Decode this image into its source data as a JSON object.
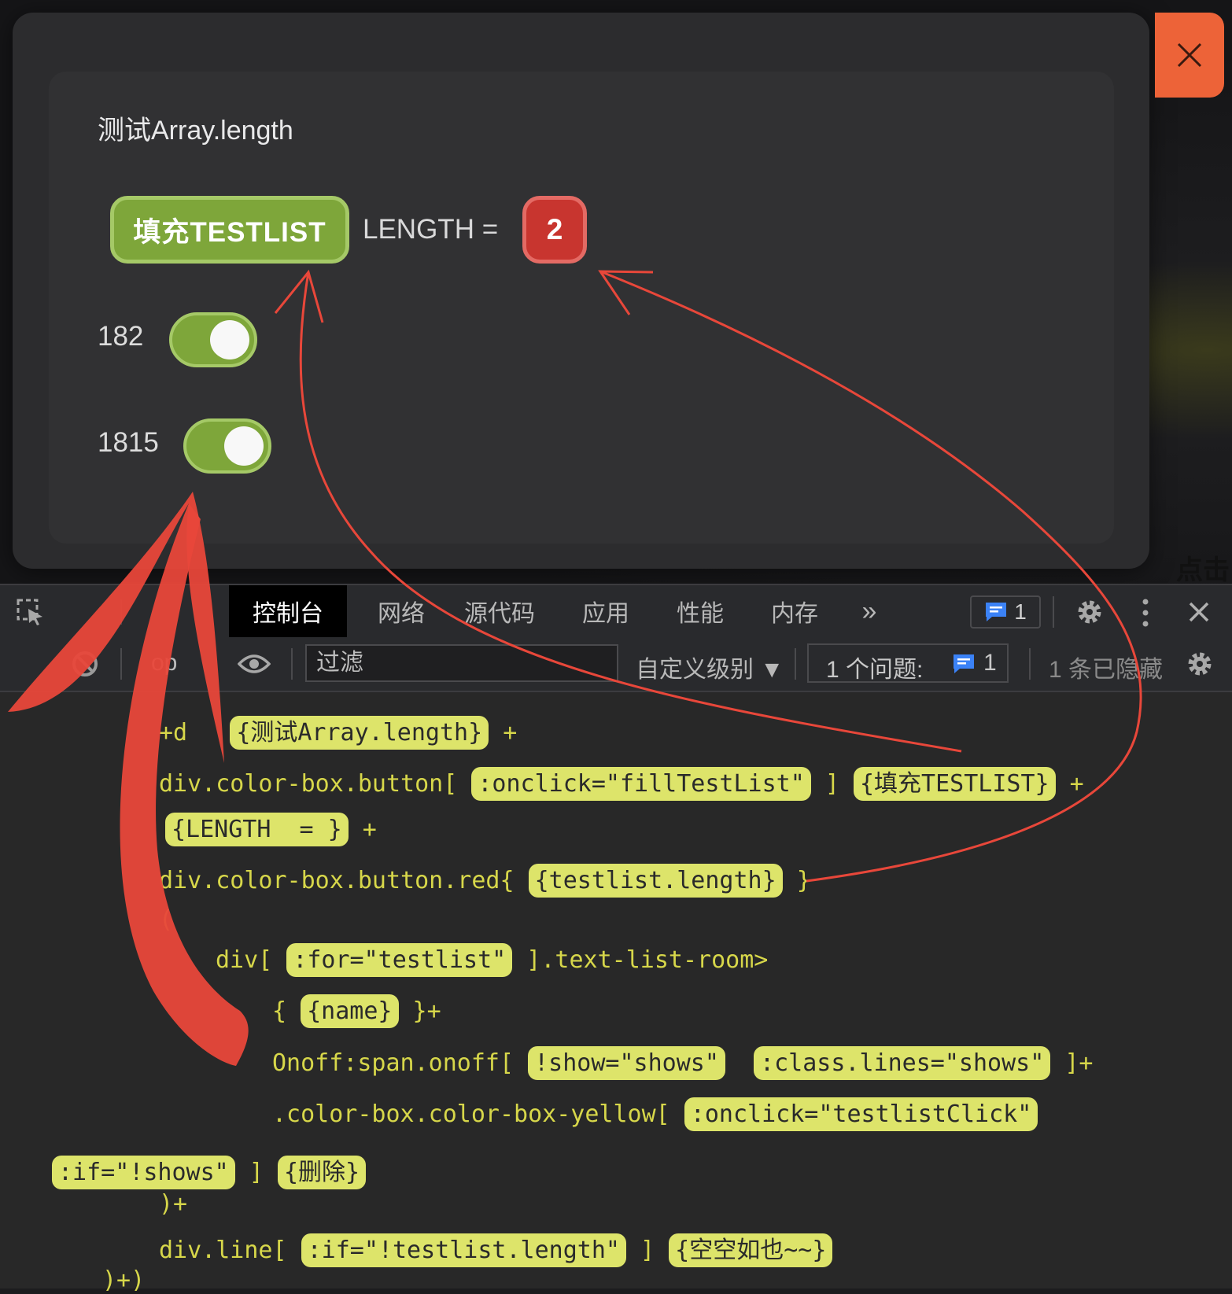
{
  "modal": {
    "title": "测试Array.length",
    "fill_button": "填充TESTLIST",
    "length_label": "LENGTH =",
    "length_value": "2",
    "rows": [
      {
        "label": "182",
        "toggle_on": true
      },
      {
        "label": "1815",
        "toggle_on": true
      }
    ],
    "click_hint": "点击"
  },
  "devtools": {
    "tabs": [
      "控制台",
      "网络",
      "源代码",
      "应用",
      "性能",
      "内存"
    ],
    "active_tab": "控制台",
    "more_tabs": "»",
    "issue_count": "1",
    "filter_placeholder": "过滤",
    "level_select": "自定义级别 ▼",
    "issues_label": "1 个问题:",
    "issues_count": "1",
    "hidden_label": "1 条已隐藏",
    "context_fragment": "op"
  },
  "code": {
    "l1_pre": "+d",
    "l1_hl": "{测试Array.length}",
    "l1_post": " +",
    "l2_pre": "div.color-box.button[",
    "l2_hl1": ":onclick=\"fillTestList\"",
    "l2_mid": " ]",
    "l2_hl2": "{填充TESTLIST}",
    "l2_post": " +",
    "l3_hl": "{LENGTH  = }",
    "l3_post": " +",
    "l4_pre": "div.color-box.button.red{",
    "l4_hl": "{testlist.length}",
    "l4_post": " }",
    "l5": "(",
    "l6_pre": "div[",
    "l6_hl": ":for=\"testlist\"",
    "l6_post": " ].text-list-room>",
    "l7_pre": "{",
    "l7_hl": "{name}",
    "l7_post": " }+",
    "l8_pre": "Onoff:span.onoff[",
    "l8_hl1": "!show=\"shows\"",
    "l8_hl2": ":class.lines=\"shows\"",
    "l8_post": " ]+",
    "l9_pre": ".color-box.color-box-yellow[",
    "l9_hl": ":onclick=\"testlistClick\"",
    "l10_hl1": ":if=\"!shows\"",
    "l10_mid": " ]",
    "l10_hl2": "{删除}",
    "l11": ")+",
    "l12_pre": "div.line[",
    "l12_hl1": ":if=\"!testlist.length\"",
    "l12_mid": " ]",
    "l12_hl2": "{空空如也~~}",
    "l13": ")+)"
  },
  "colors": {
    "accent_green": "#7ea63a",
    "accent_red": "#c8352f",
    "close_orange": "#ed6338",
    "code_yellow": "#d7d74a",
    "highlight": "#dde46a",
    "annotation_red": "#e8473a"
  }
}
